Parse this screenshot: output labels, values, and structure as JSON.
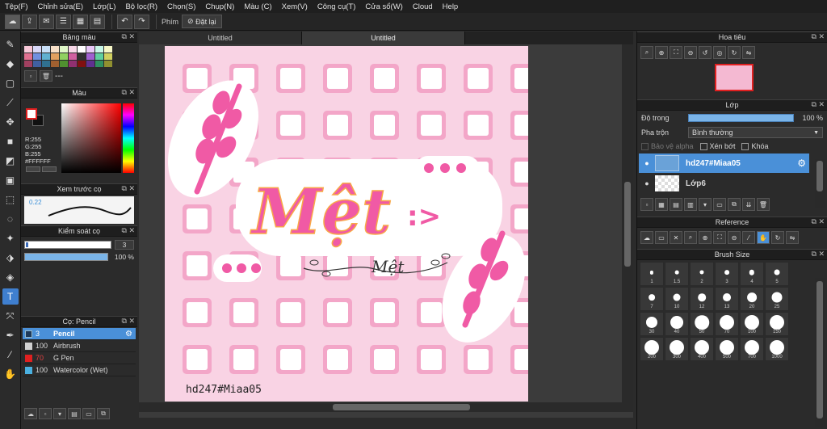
{
  "menu": [
    "Tệp(F)",
    "Chỉnh sửa(E)",
    "Lớp(L)",
    "Bộ lọc(R)",
    "Chọn(S)",
    "Chụp(N)",
    "Màu (C)",
    "Xem(V)",
    "Công cụ(T)",
    "Cửa sổ(W)",
    "Cloud",
    "Help"
  ],
  "toolbar": {
    "label": "Phím",
    "reset": "Đặt lại"
  },
  "palette": {
    "title": "Bảng màu",
    "value": "---",
    "colors": [
      "#f8c8d8",
      "#d8d8f8",
      "#c8e0f8",
      "#f8e0c8",
      "#e0f8c8",
      "#f8d8e8",
      "#ffffff",
      "#e8c8f8",
      "#c8f8e8",
      "#f8f8c8",
      "#e07090",
      "#7090e0",
      "#60b0d0",
      "#e0a060",
      "#90d060",
      "#d060a0",
      "#303030",
      "#a060d0",
      "#60d0a0",
      "#d0d060",
      "#a04060",
      "#4060a0",
      "#307090",
      "#a06030",
      "#509030",
      "#903070",
      "#801010",
      "#603090",
      "#309060",
      "#909030"
    ]
  },
  "color": {
    "title": "Màu",
    "rgb": [
      "R:255",
      "G:255",
      "B:255",
      "#FFFFFF"
    ],
    "foreground": "#FFFFFF"
  },
  "preview": {
    "title": "Xem trước cọ",
    "size": "0.22"
  },
  "brush_control": {
    "title": "Kiểm soát cọ",
    "size": "3",
    "opacity": "100 %",
    "opacity_value": 100
  },
  "brushes": {
    "title": "Cọ: Pencil",
    "items": [
      {
        "size": "3",
        "name": "Pencil",
        "color": "#1e3a5a",
        "size_color": "#ffffff"
      },
      {
        "size": "100",
        "name": "Airbrush",
        "color": "#d0d0d0",
        "size_color": "#d8d8d8"
      },
      {
        "size": "70",
        "name": "G Pen",
        "color": "#e02020",
        "size_color": "#e04040"
      },
      {
        "size": "100",
        "name": "Watercolor (Wet)",
        "color": "#4ab0e0",
        "size_color": "#d8d8d8"
      }
    ]
  },
  "tabs": [
    "Untitled",
    "Untitled"
  ],
  "canvas": {
    "signature": "hd247#Miaa05",
    "title": "Mệt",
    "suffix": ":>",
    "subtitle": "Mệt",
    "background": "#f9d3e4",
    "accent": "#f05aa5"
  },
  "navigator": {
    "title": "Hoa tiêu"
  },
  "layers": {
    "title": "Lớp",
    "opacity_label": "Độ trong",
    "opacity": "100 %",
    "opacity_value": 100,
    "blend_label": "Pha trộn",
    "blend": "Bình thường",
    "checks": [
      "Bảo vệ alpha",
      "Xén bớt",
      "Khóa"
    ],
    "items": [
      {
        "name": "hd247#Miaa05"
      },
      {
        "name": "Lớp6"
      }
    ]
  },
  "reference": {
    "title": "Reference"
  },
  "brush_size": {
    "title": "Brush Size",
    "sizes": [
      "1",
      "1.5",
      "2",
      "3",
      "4",
      "5",
      "7",
      "10",
      "12",
      "13",
      "20",
      "25",
      "30",
      "40",
      "50",
      "70",
      "100",
      "150",
      "200",
      "300",
      "400",
      "500",
      "700",
      "1000"
    ]
  }
}
